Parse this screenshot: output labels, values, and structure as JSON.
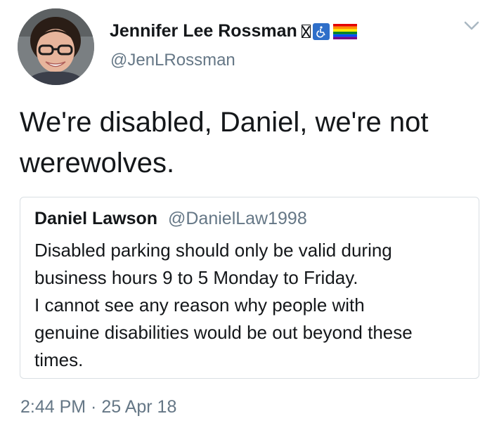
{
  "author": {
    "name": "Jennifer Lee Rossman",
    "handle": "@JenLRossman",
    "name_icons": [
      "missing-glyph-icon",
      "wheelchair-icon",
      "rainbow-flag-icon"
    ],
    "avatar": "avatar-photo"
  },
  "tweet": {
    "text": "We're disabled, Daniel, we're not werewolves.",
    "timestamp": "2:44 PM · 25 Apr 18"
  },
  "quoted_tweet": {
    "name": "Daniel Lawson",
    "handle": "@DanielLaw1998",
    "lines": [
      "Disabled parking should only be valid during",
      "business hours 9 to 5 Monday to Friday.",
      "I cannot see any reason why people with",
      "genuine disabilities would be out beyond these",
      "times."
    ]
  },
  "colors": {
    "text": "#14171a",
    "secondary_text": "#657786",
    "border": "#d9dfe3",
    "wheelchair_blue": "#2f6fc9"
  },
  "icons": {
    "menu": "chevron-down-icon"
  }
}
